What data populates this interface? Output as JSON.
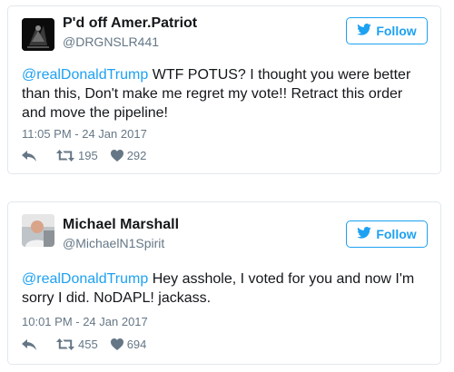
{
  "tweets": [
    {
      "display_name": "P'd off Amer.Patriot",
      "handle": "@DRGNSLR441",
      "follow_label": "Follow",
      "text_mention": "@realDonaldTrump",
      "text_body": " WTF POTUS? I thought you were better than this, Don't make me regret my vote!! Retract this order and move the pipeline!",
      "timestamp": "11:05 PM - 24 Jan 2017",
      "retweets": "195",
      "likes": "292"
    },
    {
      "display_name": "Michael Marshall",
      "handle": "@MichaelN1Spirit",
      "follow_label": "Follow",
      "text_mention": "@realDonaldTrump",
      "text_body": " Hey asshole, I voted for you and now I'm sorry I did. NoDAPL! jackass.",
      "timestamp": "10:01 PM - 24 Jan 2017",
      "retweets": "455",
      "likes": "694"
    }
  ],
  "colors": {
    "accent": "#1da1f2",
    "muted": "#657786",
    "text": "#14171a",
    "border": "#e1e8ed"
  },
  "icons": {
    "follow": "bird-icon",
    "reply": "reply-icon",
    "retweet": "retweet-icon",
    "like": "heart-icon"
  }
}
